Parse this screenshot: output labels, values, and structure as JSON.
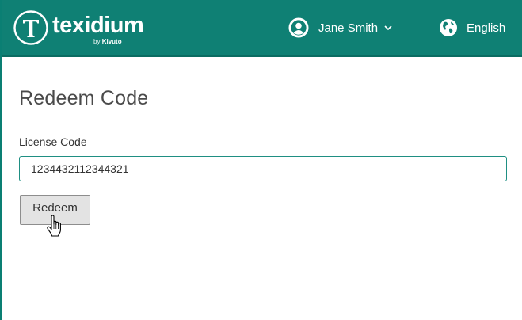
{
  "header": {
    "brand_name": "texidium",
    "brand_by": "by",
    "brand_vendor": "Kivuto",
    "user_name": "Jane Smith",
    "language": "English",
    "icons": {
      "logo": "texidium-logo-icon",
      "user": "user-avatar-icon",
      "dropdown": "chevron-down-icon",
      "language": "globe-icon"
    }
  },
  "page": {
    "title": "Redeem Code"
  },
  "form": {
    "license_label": "License Code",
    "license_value": "1234432112344321",
    "redeem_label": "Redeem"
  },
  "colors": {
    "brand": "#0f8074",
    "input_border": "#1f8f83",
    "button_bg": "#e3e3e3"
  }
}
